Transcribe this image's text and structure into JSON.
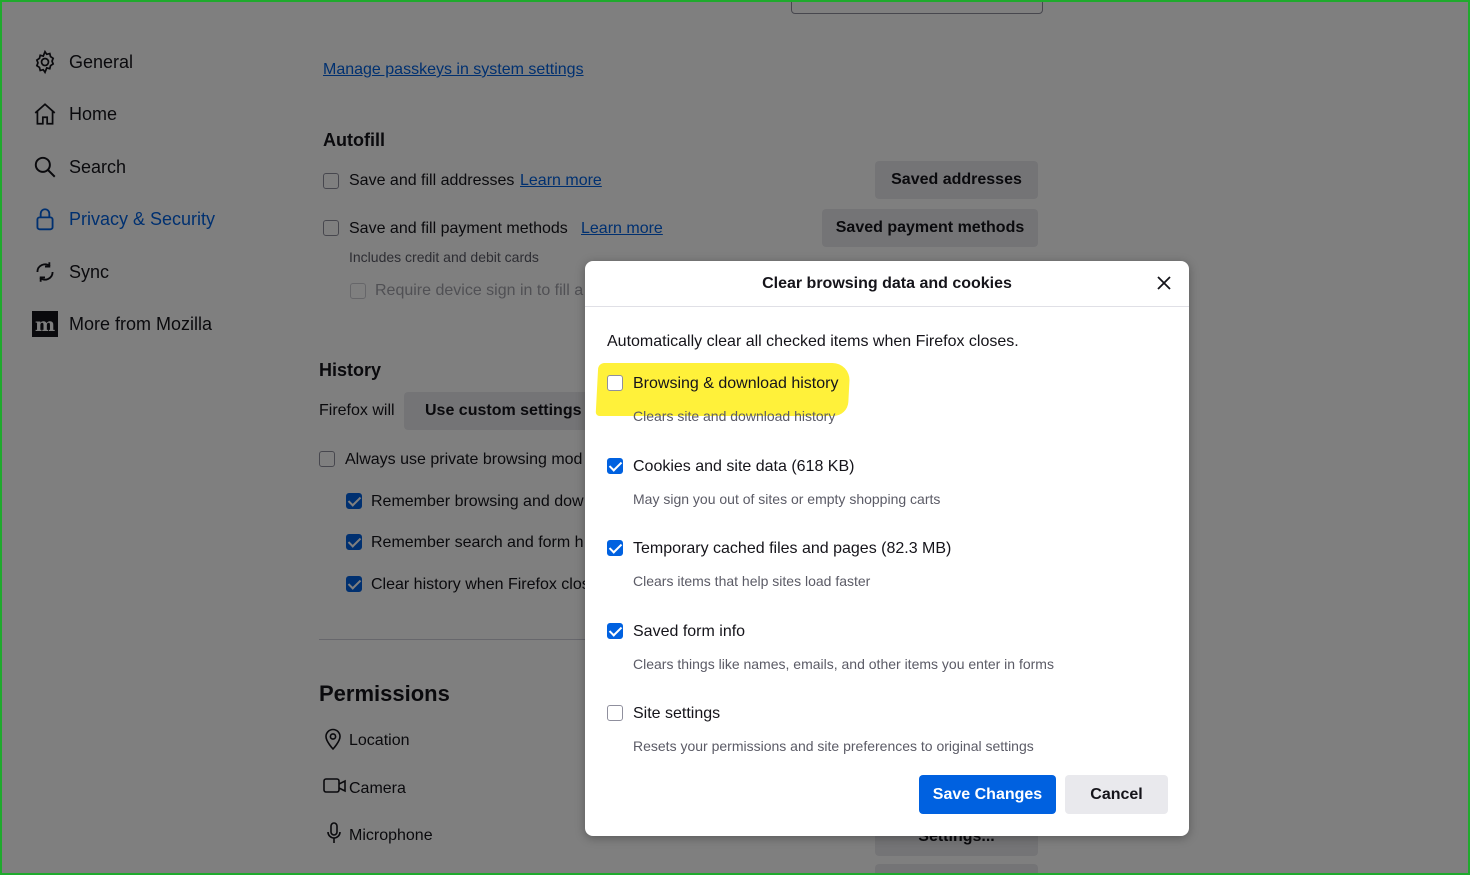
{
  "sidebar": {
    "items": [
      {
        "label": "General",
        "icon": "gear-icon"
      },
      {
        "label": "Home",
        "icon": "home-icon"
      },
      {
        "label": "Search",
        "icon": "search-icon"
      },
      {
        "label": "Privacy & Security",
        "icon": "lock-icon",
        "active": true
      },
      {
        "label": "Sync",
        "icon": "sync-icon"
      },
      {
        "label": "More from Mozilla",
        "icon": "mozilla-icon"
      }
    ]
  },
  "passwords": {
    "manage_passkeys_link": "Manage passkeys in system settings"
  },
  "autofill": {
    "heading": "Autofill",
    "addresses_label": "Save and fill addresses",
    "addresses_learn_more": "Learn more",
    "saved_addresses_button": "Saved addresses",
    "payment_label": "Save and fill payment methods",
    "payment_learn_more": "Learn more",
    "saved_payment_button": "Saved payment methods",
    "payment_sub": "Includes credit and debit cards",
    "require_signin_label": "Require device sign in to fill a"
  },
  "history": {
    "heading": "History",
    "firefox_will_label": "Firefox will",
    "mode_select_value": "Use custom settings f",
    "private_mode_label": "Always use private browsing mod",
    "remember_browsing_label": "Remember browsing and dow",
    "remember_search_label": "Remember search and form h",
    "clear_on_close_label": "Clear history when Firefox clos"
  },
  "permissions": {
    "heading": "Permissions",
    "location_label": "Location",
    "camera_label": "Camera",
    "microphone_label": "Microphone",
    "settings_button": "Settings..."
  },
  "dialog": {
    "title": "Clear browsing data and cookies",
    "intro": "Automatically clear all checked items when Firefox closes.",
    "items": [
      {
        "label": "Browsing & download history",
        "description": "Clears site and download history",
        "checked": false
      },
      {
        "label": "Cookies and site data (618 KB)",
        "description": "May sign you out of sites or empty shopping carts",
        "checked": true
      },
      {
        "label": "Temporary cached files and pages (82.3 MB)",
        "description": "Clears items that help sites load faster",
        "checked": true
      },
      {
        "label": "Saved form info",
        "description": "Clears things like names, emails, and other items you enter in forms",
        "checked": true
      },
      {
        "label": "Site settings",
        "description": "Resets your permissions and site preferences to original settings",
        "checked": false
      }
    ],
    "save_button": "Save Changes",
    "cancel_button": "Cancel"
  },
  "colors": {
    "accent": "#0061e0",
    "highlight": "#fff13a",
    "frame_border": "#1faa2d"
  }
}
